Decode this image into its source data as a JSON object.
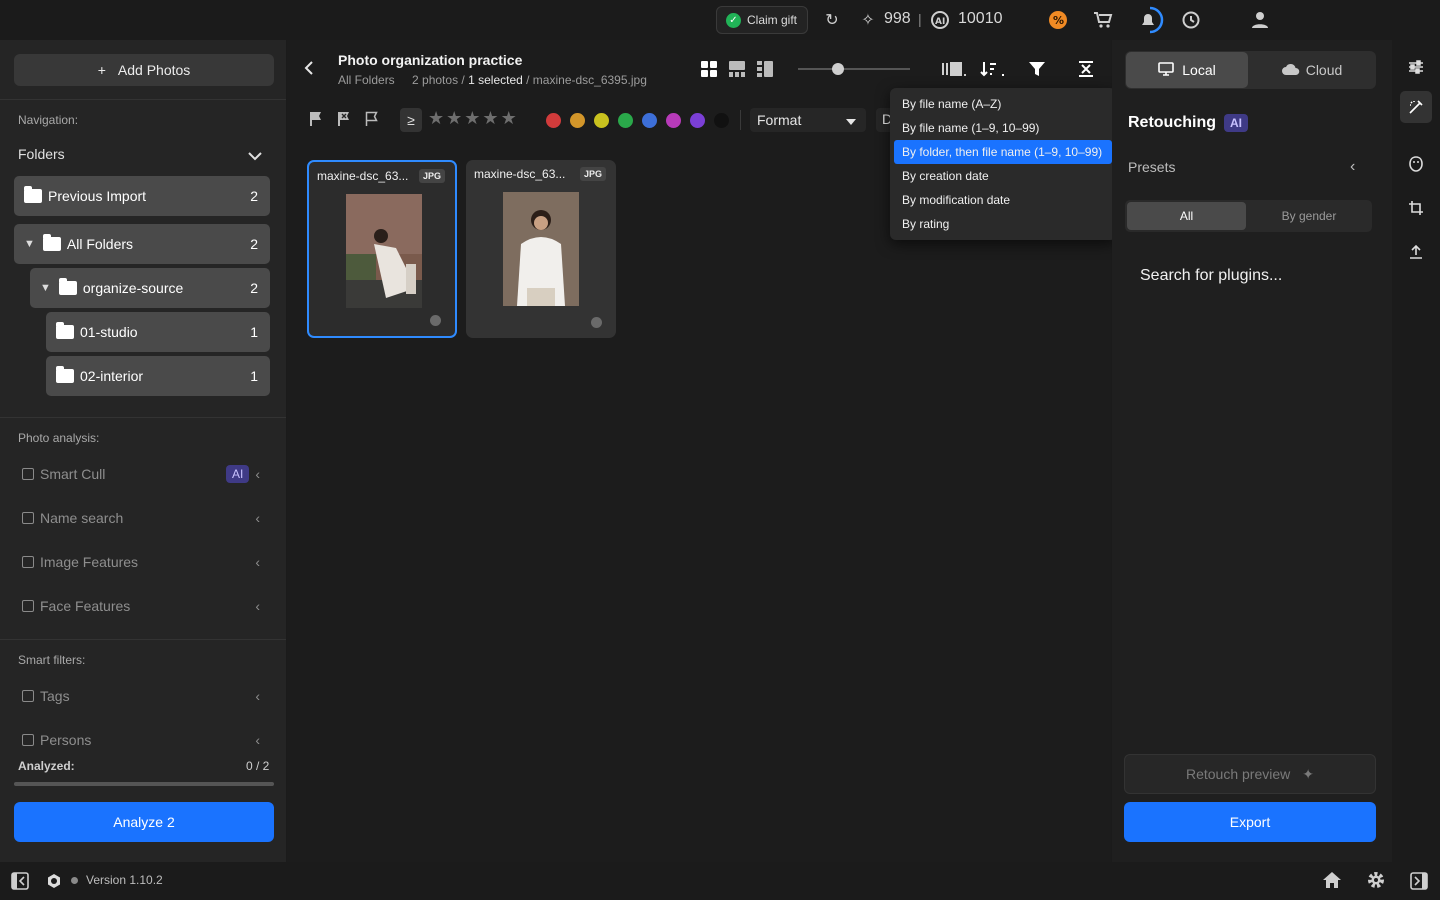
{
  "topbar": {
    "claim_gift": "Claim gift",
    "credits": "998",
    "separator": "|",
    "ai_credits": "10010"
  },
  "left": {
    "add_photos": "Add Photos",
    "navigation_label": "Navigation:",
    "folders_label": "Folders",
    "folders": [
      {
        "name": "Previous Import",
        "count": "2"
      },
      {
        "name": "All Folders",
        "count": "2"
      },
      {
        "name": "organize-source",
        "count": "2"
      },
      {
        "name": "01-studio",
        "count": "1"
      },
      {
        "name": "02-interior",
        "count": "1"
      }
    ],
    "photo_analysis_label": "Photo analysis:",
    "analysis": [
      "Smart Cull",
      "Name search",
      "Image Features",
      "Face Features"
    ],
    "ai_badge": "AI",
    "smart_filters_label": "Smart filters:",
    "filters": [
      "Tags",
      "Persons"
    ],
    "analyzed_label": "Analyzed:",
    "analyzed_value": "0 / 2",
    "analyze_button": "Analyze 2"
  },
  "center": {
    "title": "Photo organization practice",
    "crumb_folder": "All Folders",
    "crumb_photos": "2 photos /",
    "crumb_selected": "1 selected",
    "crumb_file": "/ maxine-dsc_6395.jpg",
    "filter_ge": "≥",
    "format_label": "Format",
    "clipped_letter": "D",
    "color_labels": [
      "#d13b3b",
      "#d3962a",
      "#c9c21f",
      "#2aa84a",
      "#3d6fd8",
      "#b73ab9",
      "#7b3fd6",
      "#111111"
    ],
    "photos": [
      {
        "name": "maxine-dsc_63...",
        "type": "JPG",
        "selected": true
      },
      {
        "name": "maxine-dsc_63...",
        "type": "JPG",
        "selected": false
      }
    ]
  },
  "sort_menu": {
    "items": [
      "By file name (A–Z)",
      "By file name (1–9, 10–99)",
      "By folder, then file name (1–9, 10–99)",
      "By creation date",
      "By modification date",
      "By rating"
    ],
    "active_index": 2
  },
  "right": {
    "local": "Local",
    "cloud": "Cloud",
    "retouching": "Retouching",
    "ai_badge": "AI",
    "presets": "Presets",
    "all": "All",
    "by_gender": "By gender",
    "search_plugins": "Search for plugins...",
    "retouch_preview": "Retouch preview",
    "export": "Export"
  },
  "bottom": {
    "version": "Version 1.10.2"
  },
  "colors": {
    "accent": "#1a73ff",
    "ai_badge": "#3f3a86"
  }
}
